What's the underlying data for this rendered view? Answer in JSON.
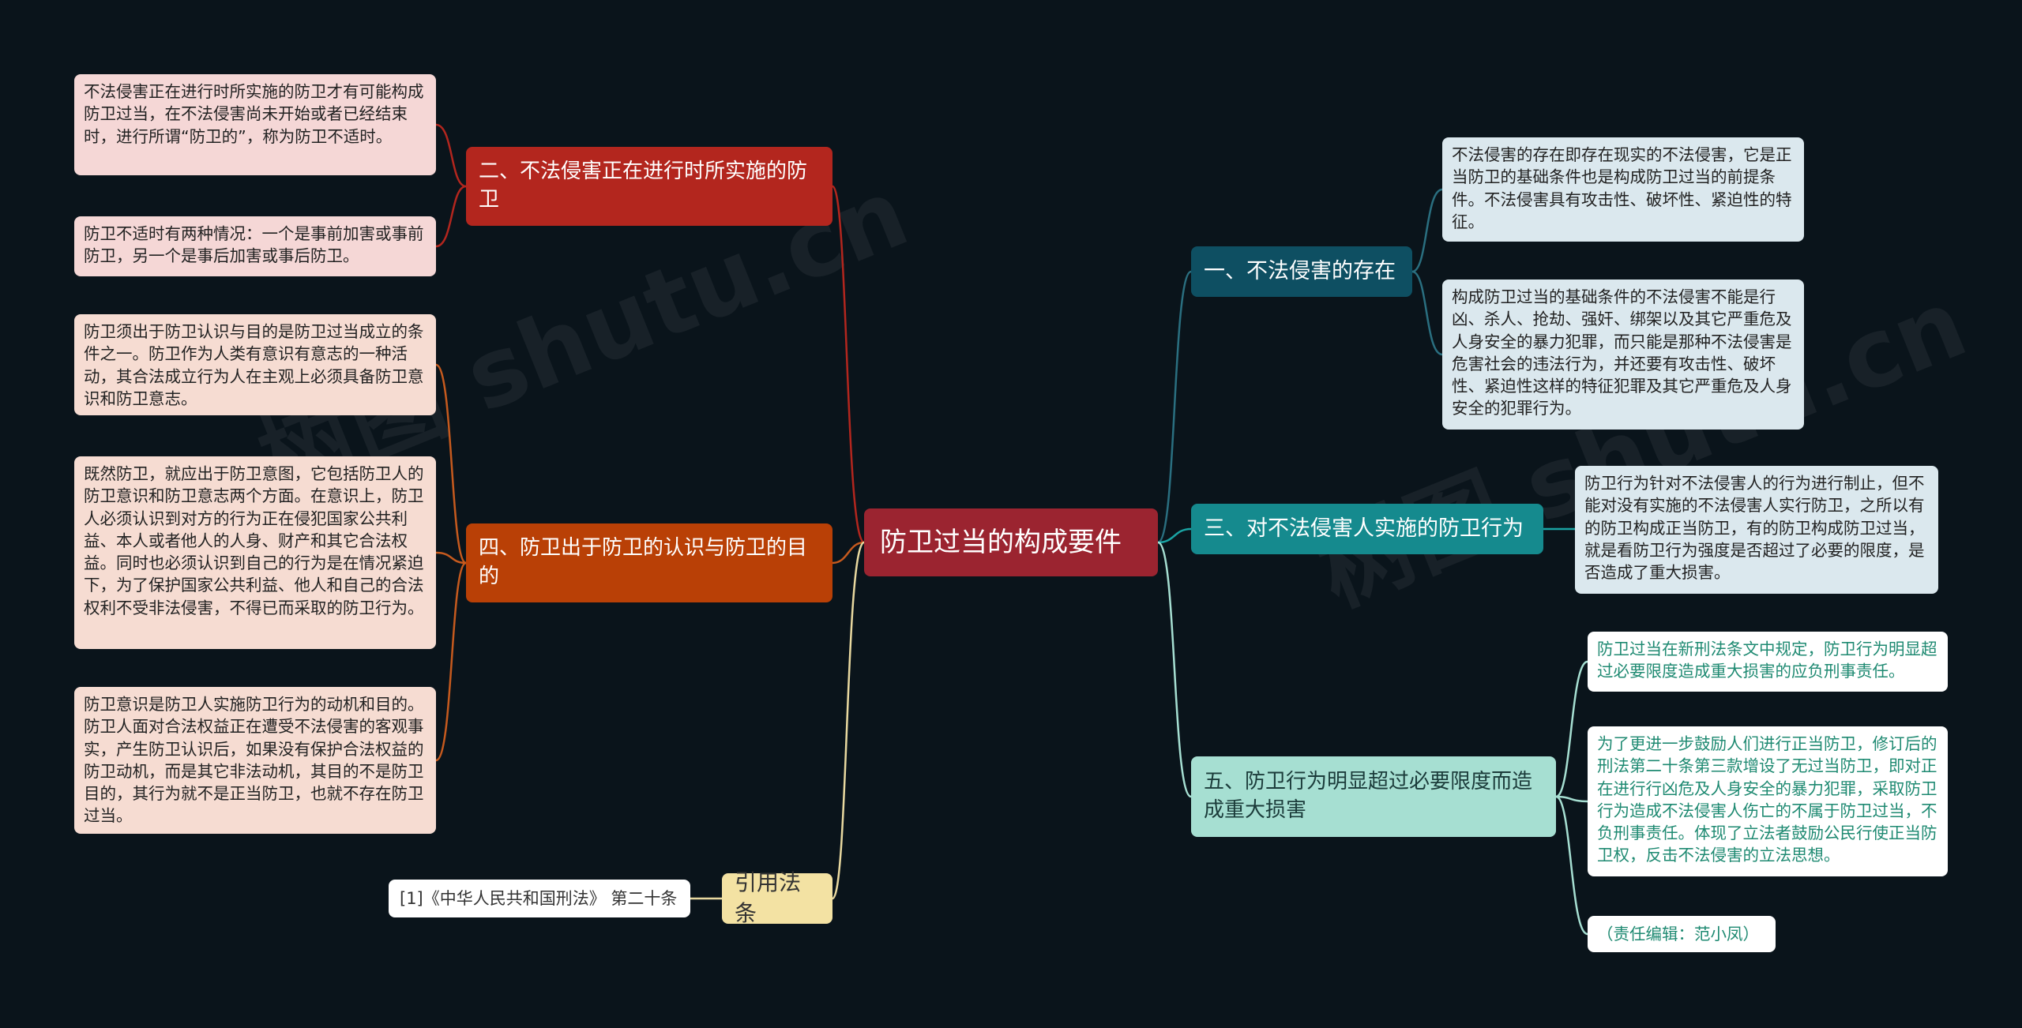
{
  "center": {
    "title": "防卫过当的构成要件"
  },
  "left_branches": [
    {
      "title": "二、不法侵害正在进行时所实施的防卫",
      "leaves": [
        "不法侵害正在进行时所实施的防卫才有可能构成防卫过当，在不法侵害尚未开始或者已经结束时，进行所谓“防卫的”，称为防卫不适时。",
        "防卫不适时有两种情况：一个是事前加害或事前防卫，另一个是事后加害或事后防卫。"
      ]
    },
    {
      "title": "四、防卫出于防卫的认识与防卫的目的",
      "leaves": [
        "防卫须出于防卫认识与目的是防卫过当成立的条件之一。防卫作为人类有意识有意志的一种活动，其合法成立行为人在主观上必须具备防卫意识和防卫意志。",
        "既然防卫，就应出于防卫意图，它包括防卫人的防卫意识和防卫意志两个方面。在意识上，防卫人必须认识到对方的行为正在侵犯国家公共利益、本人或者他人的人身、财产和其它合法权益。同时也必须认识到自己的行为是在情况紧迫下，为了保护国家公共利益、他人和自己的合法权利不受非法侵害，不得已而采取的防卫行为。",
        "防卫意识是防卫人实施防卫行为的动机和目的。防卫人面对合法权益正在遭受不法侵害的客观事实，产生防卫认识后，如果没有保护合法权益的防卫动机，而是其它非法动机，其目的不是防卫目的，其行为就不是正当防卫，也就不存在防卫过当。"
      ]
    },
    {
      "title": "引用法条",
      "leaves": [
        "[1]《中华人民共和国刑法》 第二十条"
      ]
    }
  ],
  "right_branches": [
    {
      "title": "一、不法侵害的存在",
      "leaves": [
        "不法侵害的存在即存在现实的不法侵害，它是正当防卫的基础条件也是构成防卫过当的前提条件。不法侵害具有攻击性、破坏性、紧迫性的特征。",
        "构成防卫过当的基础条件的不法侵害不能是行凶、杀人、抢劫、强奸、绑架以及其它严重危及人身安全的暴力犯罪，而只能是那种不法侵害是危害社会的违法行为，并还要有攻击性、破坏性、紧迫性这样的特征犯罪及其它严重危及人身安全的犯罪行为。"
      ]
    },
    {
      "title": "三、对不法侵害人实施的防卫行为",
      "leaves": [
        "防卫行为针对不法侵害人的行为进行制止，但不能对没有实施的不法侵害人实行防卫，之所以有的防卫构成正当防卫，有的防卫构成防卫过当，就是看防卫行为强度是否超过了必要的限度，是否造成了重大损害。"
      ]
    },
    {
      "title": "五、防卫行为明显超过必要限度而造成重大损害",
      "leaves": [
        "防卫过当在新刑法条文中规定，防卫行为明显超过必要限度造成重大损害的应负刑事责任。",
        "为了更进一步鼓励人们进行正当防卫，修订后的刑法第二十条第三款增设了无过当防卫，即对正在进行行凶危及人身安全的暴力犯罪，采取防卫行为造成不法侵害人伤亡的不属于防卫过当，不负刑事责任。体现了立法者鼓励公民行使正当防卫权，反击不法侵害的立法思想。",
        "（责任编辑：范小凤）"
      ]
    }
  ],
  "colors": {
    "background": "#0a141b",
    "center": "#9b2430",
    "branch_2": "#b3261e",
    "branch_4": "#b94006",
    "ref": "#f3e2a3",
    "branch_1": "#0e4f62",
    "branch_3": "#158a8e",
    "branch_5": "#a6dfd2",
    "line_red": "#b3261e",
    "line_orange": "#c65a1e",
    "line_yellow": "#e9d9a0",
    "line_teal": "#2a6f80",
    "line_teal2": "#1aa3a3",
    "line_green": "#a6dfd2"
  }
}
